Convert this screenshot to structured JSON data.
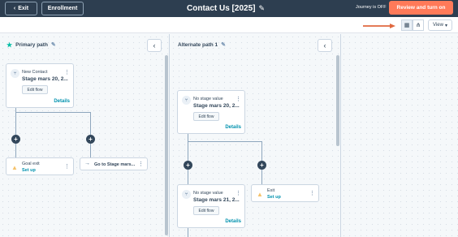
{
  "topbar": {
    "exit_label": "Exit",
    "enrollment_label": "Enrollment",
    "title": "Contact Us [2025]",
    "journey_status": "Journey is OFF",
    "review_label": "Review and turn on"
  },
  "toolbar": {
    "view_label": "View"
  },
  "paths": {
    "primary": {
      "label": "Primary path"
    },
    "alternate": {
      "label": "Alternate path 1"
    }
  },
  "cards": {
    "new_contact": {
      "title": "New Contact",
      "subtitle": "Stage mars 20, 2...",
      "edit_flow": "Edit flow",
      "details": "Details"
    },
    "goal_exit": {
      "title": "Goal exit",
      "action": "Set up"
    },
    "go_to": {
      "title": "Go to Stage mars..."
    },
    "alt_stage_1": {
      "title": "No stage value",
      "subtitle": "Stage mars 20, 2...",
      "edit_flow": "Edit flow",
      "details": "Details"
    },
    "alt_stage_2": {
      "title": "No stage value",
      "subtitle": "Stage mars 21, 2...",
      "edit_flow": "Edit flow",
      "details": "Details"
    },
    "alt_exit": {
      "title": "Exit",
      "action": "Set up"
    }
  },
  "colors": {
    "topbar_bg": "#2d3e50",
    "accent": "#ff7a59",
    "link": "#0091ae",
    "annotation_arrow": "#e0683f"
  }
}
